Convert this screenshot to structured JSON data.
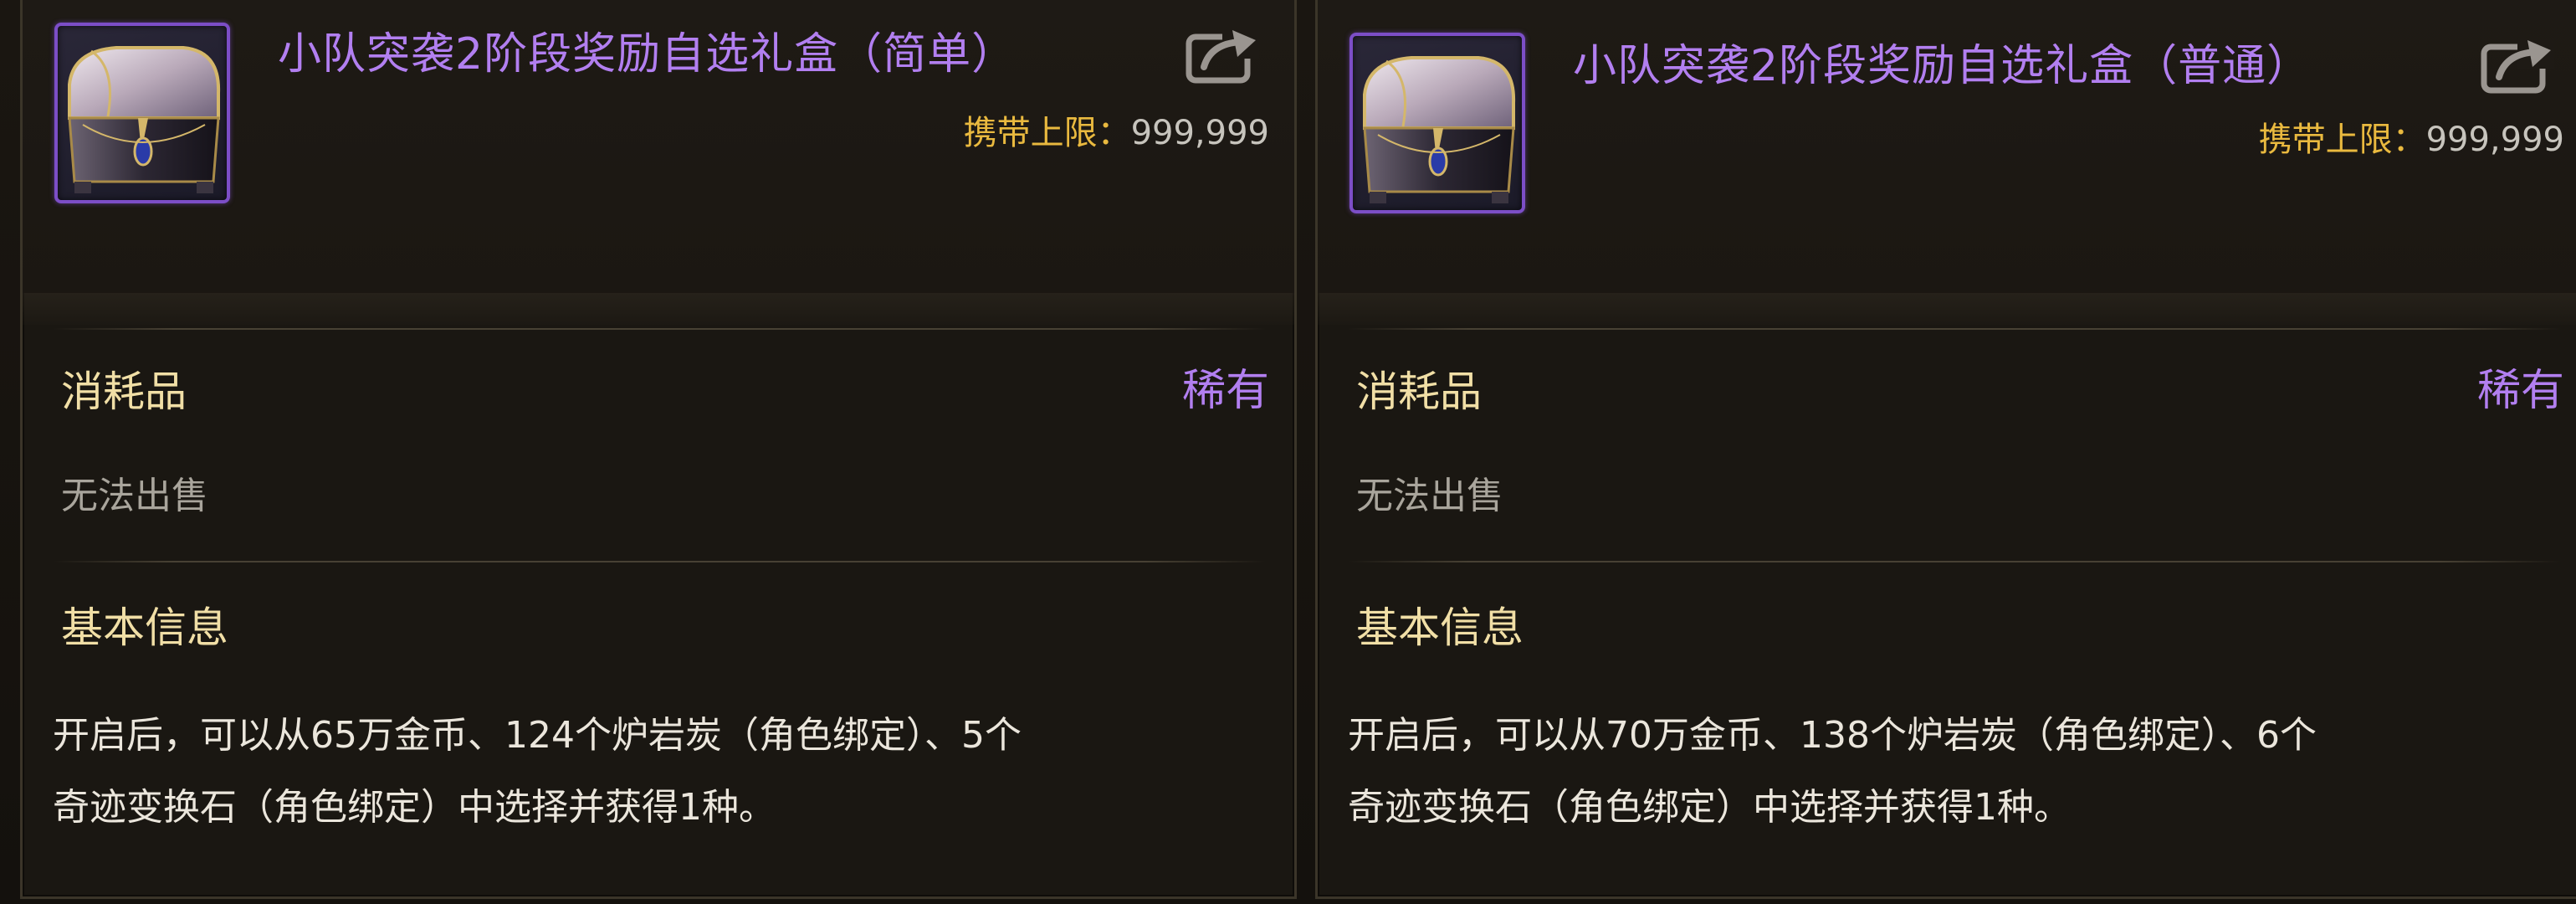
{
  "cards": [
    {
      "title": "小队突袭2阶段奖励自选礼盒（简单）",
      "carry_limit_label": "携带上限：",
      "carry_limit_value": "999,999",
      "type": "消耗品",
      "rarity": "稀有",
      "sell_status": "无法出售",
      "section_title": "基本信息",
      "description_lines": [
        "开启后，可以从65万金币、124个炉岩炭（角色绑定）、5个",
        "奇迹变换石（角色绑定）中选择并获得1种。"
      ],
      "item_icon": "treasure-chest-icon",
      "share_icon": "share-icon"
    },
    {
      "title": "小队突袭2阶段奖励自选礼盒（普通）",
      "carry_limit_label": "携带上限：",
      "carry_limit_value": "999,999",
      "type": "消耗品",
      "rarity": "稀有",
      "sell_status": "无法出售",
      "section_title": "基本信息",
      "description_lines": [
        "开启后，可以从70万金币、138个炉岩炭（角色绑定）、6个",
        "奇迹变换石（角色绑定）中选择并获得1种。"
      ],
      "item_icon": "treasure-chest-icon",
      "share_icon": "share-icon"
    }
  ],
  "colors": {
    "rarity_purple": "#b27ff0",
    "label_gold": "#e9b93f",
    "heading_cream": "#f1dfa6",
    "muted_gray": "#a9a59c",
    "body_text": "#ebe6dc",
    "panel_bg": "#1c1813",
    "icon_border": "#7c4ec7"
  }
}
